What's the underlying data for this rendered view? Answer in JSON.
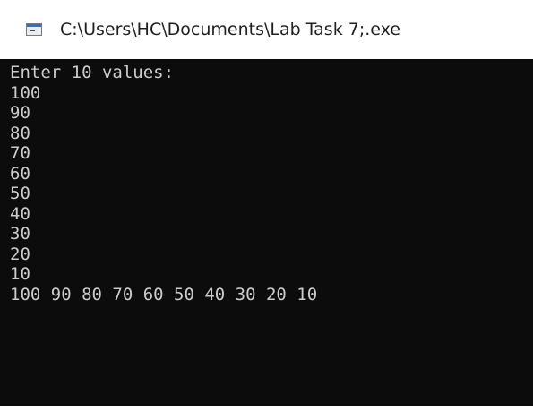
{
  "window": {
    "title": "C:\\Users\\HC\\Documents\\Lab Task 7;.exe",
    "icon": "console-app-icon"
  },
  "console": {
    "lines": [
      "Enter 10 values:",
      "100",
      "90",
      "80",
      "70",
      "60",
      "50",
      "40",
      "30",
      "20",
      "10",
      "100 90 80 70 60 50 40 30 20 10"
    ]
  },
  "colors": {
    "console_background": "#0c0c0c",
    "console_text": "#cccccc",
    "titlebar_background": "#ffffff"
  }
}
